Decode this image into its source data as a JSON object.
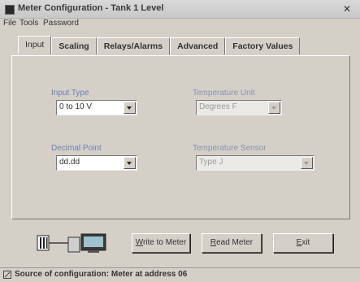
{
  "window": {
    "title": "Meter Configuration - Tank 1 Level"
  },
  "menu": [
    "File",
    "Tools",
    "Password"
  ],
  "tabs": [
    "Input",
    "Scaling",
    "Relays/Alarms",
    "Advanced",
    "Factory Values"
  ],
  "active_tab": "Input",
  "input_panel": {
    "input_type": {
      "label": "Input Type",
      "value": "0 to 10 V",
      "enabled": true
    },
    "decimal_point": {
      "label": "Decimal Point",
      "value": "dd.dd",
      "enabled": true
    },
    "temperature_unit": {
      "label": "Temperature Unit",
      "value": "Degrees F",
      "enabled": false
    },
    "temperature_sensor": {
      "label": "Temperature Sensor",
      "value": "Type J",
      "enabled": false
    }
  },
  "buttons": {
    "write_to_meter": {
      "prefix": "W",
      "rest": "rite to Meter"
    },
    "read_meter": {
      "prefix": "R",
      "rest": "ead Meter"
    },
    "exit": {
      "prefix": "",
      "mid": "E",
      "rest": "xit"
    }
  },
  "status": {
    "text": "Source of configuration: Meter at address 06"
  },
  "icons": {
    "app": "app-icon",
    "close": "close-icon",
    "device": "meter-pc-link-icon",
    "status": "status-info-icon"
  }
}
